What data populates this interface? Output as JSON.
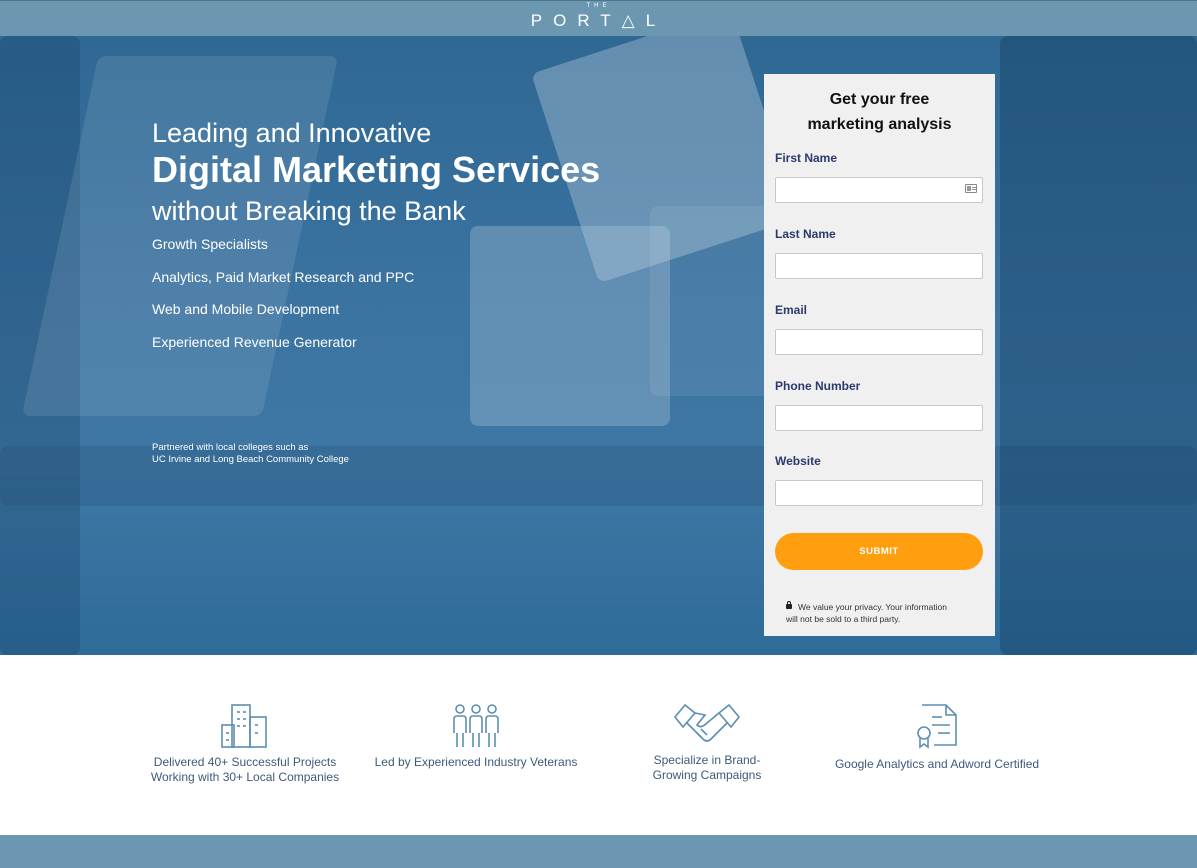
{
  "header": {
    "logo_small": "THE",
    "logo_main": "PORT△L"
  },
  "hero": {
    "headline_line1": "Leading and Innovative",
    "headline_line2": "Digital Marketing Services",
    "headline_line3": "without Breaking the Bank",
    "features": [
      "Growth Specialists",
      "Analytics, Paid Market Research and PPC",
      "Web and Mobile Development",
      "Experienced Revenue Generator"
    ],
    "partner_line1": "Partnered with local colleges such as",
    "partner_line2": "UC Irvine and Long Beach Community College"
  },
  "form": {
    "title_line1": "Get your free",
    "title_line2": "marketing analysis",
    "fields": [
      {
        "label": "First Name",
        "value": ""
      },
      {
        "label": "Last Name",
        "value": ""
      },
      {
        "label": "Email",
        "value": ""
      },
      {
        "label": "Phone Number",
        "value": ""
      },
      {
        "label": "Website",
        "value": ""
      }
    ],
    "submit_label": "SUBMIT",
    "privacy_line1": "We value your privacy. Your information",
    "privacy_line2": "will not be sold to a third party."
  },
  "benefits": [
    {
      "icon": "buildings-icon",
      "line1": "Delivered 40+ Successful Projects",
      "line2": "Working with 30+ Local Companies"
    },
    {
      "icon": "team-icon",
      "line1": "Led by Experienced Industry Veterans",
      "line2": ""
    },
    {
      "icon": "handshake-icon",
      "line1": "Specialize in Brand-",
      "line2": "Growing Campaigns"
    },
    {
      "icon": "certificate-icon",
      "line1": "Google Analytics and Adword Certified",
      "line2": ""
    }
  ],
  "colors": {
    "brand_bar": "#6b98b0",
    "hero_blue": "#3a72a0",
    "accent_orange": "#ff9f0f",
    "label_navy": "#2b3a6b"
  }
}
